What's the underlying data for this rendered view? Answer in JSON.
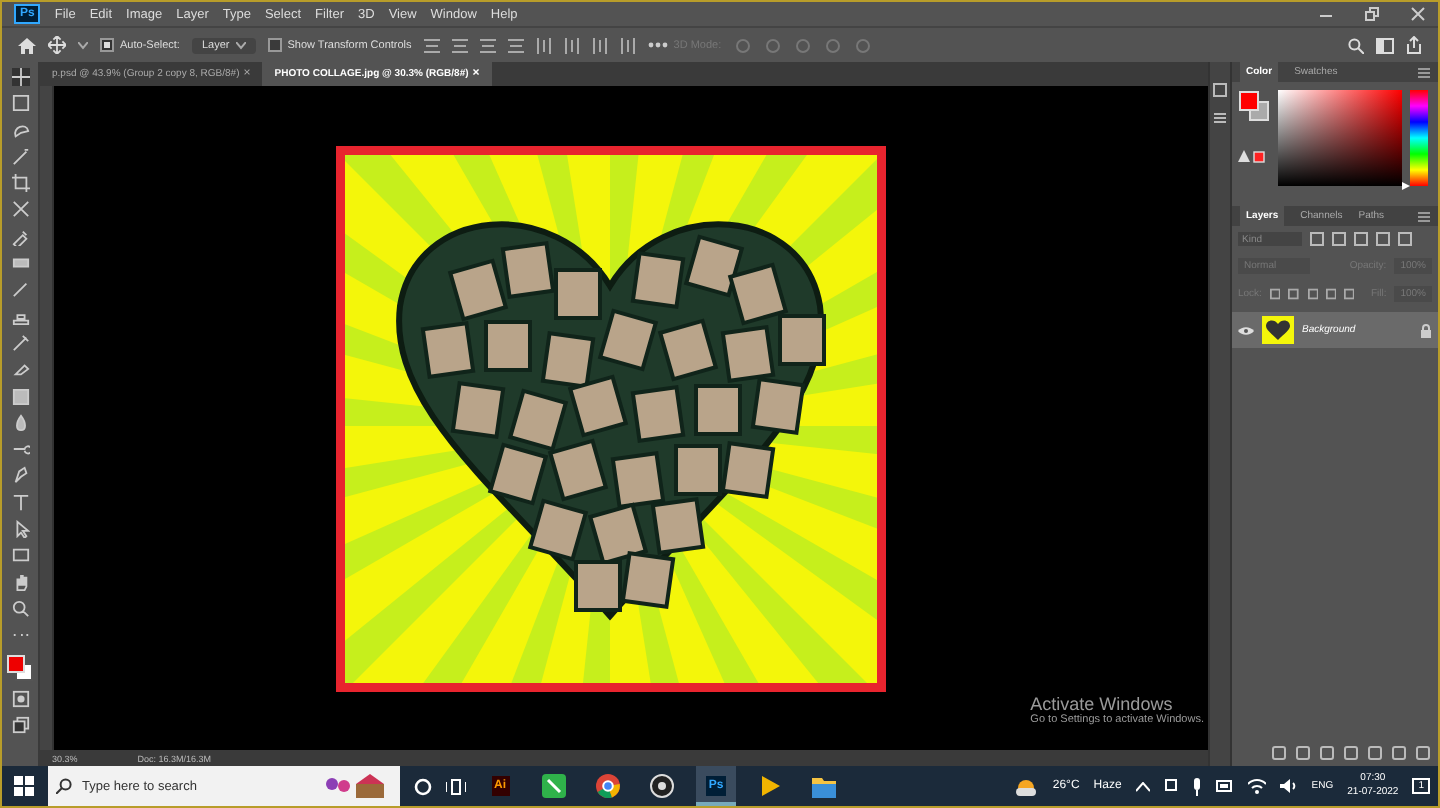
{
  "app_logo": "Ps",
  "menu": [
    "File",
    "Edit",
    "Image",
    "Layer",
    "Type",
    "Select",
    "Filter",
    "3D",
    "View",
    "Window",
    "Help"
  ],
  "options": {
    "auto_select": {
      "label": "Auto-Select:",
      "checked": true
    },
    "target": "Layer",
    "transform": {
      "label": "Show Transform Controls",
      "checked": false
    },
    "mode_3d": "3D Mode:"
  },
  "tabs": [
    {
      "label": "p.psd @ 43.9% (Group 2 copy 8, RGB/8#)",
      "close": "×",
      "selected": false
    },
    {
      "label": "PHOTO COLLAGE.jpg @ 30.3% (RGB/8#)",
      "close": "×",
      "selected": true
    }
  ],
  "status": {
    "zoom": "30.3%",
    "doc": "Doc: 16.3M/16.3M"
  },
  "color_panel": {
    "tabs": [
      {
        "label": "Color",
        "selected": true
      },
      {
        "label": "Swatches",
        "selected": false
      }
    ],
    "hue": {
      "level": 0
    }
  },
  "layers_panel": {
    "tabs": [
      {
        "label": "Layers",
        "selected": true
      },
      {
        "label": "Channels",
        "selected": false
      },
      {
        "label": "Paths",
        "selected": false
      }
    ],
    "filter_placeholder": "Kind",
    "blend": "Normal",
    "opacity_label": "Opacity:",
    "opacity": "100%",
    "lock_label": "Lock:",
    "fill_label": "Fill:",
    "fill": "100%",
    "layers": [
      {
        "name": "Background",
        "visible": true,
        "locked": true
      }
    ]
  },
  "activation": {
    "title": "Activate Windows",
    "message": "Go to Settings to activate Windows."
  },
  "taskbar": {
    "search_placeholder": "Type here to search",
    "apps": [
      {
        "kind": "ai",
        "label": "Ai",
        "selected": false
      },
      {
        "kind": "green",
        "selected": false
      },
      {
        "kind": "chrome",
        "selected": false
      },
      {
        "kind": "obs",
        "selected": false
      },
      {
        "kind": "ps",
        "label": "Ps",
        "selected": true
      },
      {
        "kind": "player",
        "selected": false
      },
      {
        "kind": "folder",
        "selected": false
      }
    ],
    "weather": {
      "temp": "26°C",
      "condition": "Haze"
    },
    "language": "ENG",
    "time": "07:30",
    "date": "21-07-2022",
    "notifications": "1"
  }
}
